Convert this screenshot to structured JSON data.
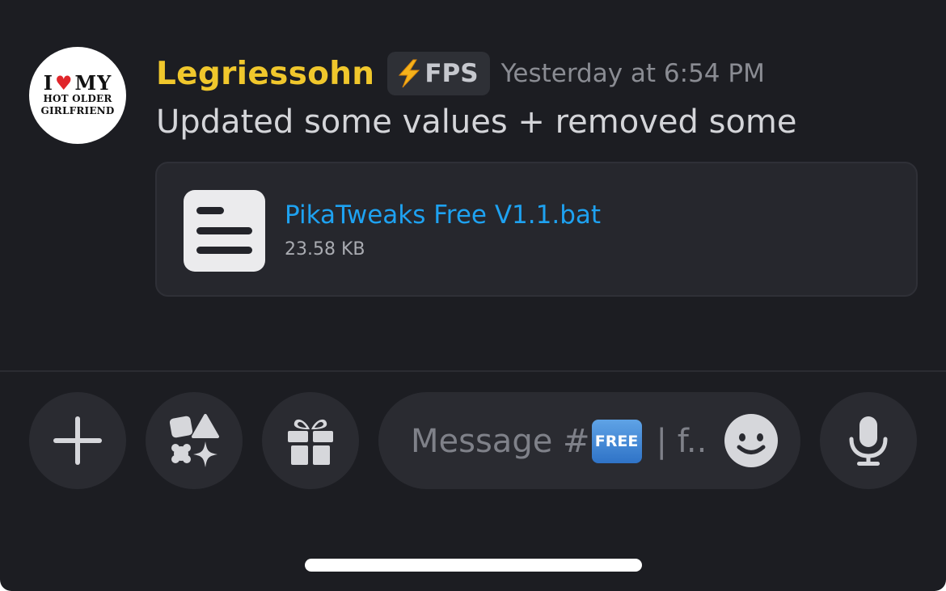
{
  "message": {
    "avatar": {
      "line1_before": "I",
      "line1_heart": "♥",
      "line1_after": "MY",
      "line2": "HOT OLDER",
      "line3": "GIRLFRIEND"
    },
    "username": "Legriessohn",
    "tag": {
      "icon": "lightning-bolt-icon",
      "label": "FPS"
    },
    "timestamp": "Yesterday at 6:54 PM",
    "text": "Updated some values + removed some",
    "attachment": {
      "icon": "text-file-icon",
      "filename": "PikaTweaks Free V1.1.bat",
      "size": "23.58 KB"
    }
  },
  "composer": {
    "buttons": [
      {
        "name": "add-button",
        "icon": "plus-icon"
      },
      {
        "name": "apps-button",
        "icon": "apps-icon"
      },
      {
        "name": "gift-button",
        "icon": "gift-icon"
      }
    ],
    "placeholder_prefix": "Message #",
    "placeholder_badge": "FREE",
    "placeholder_suffix": "| f..",
    "emoji_icon": "smiley-icon",
    "mic_icon": "microphone-icon"
  },
  "colors": {
    "background": "#1c1d22",
    "username": "#f0c72c",
    "link": "#1ea2f1",
    "panel": "#26272d",
    "button": "#2a2b31"
  }
}
